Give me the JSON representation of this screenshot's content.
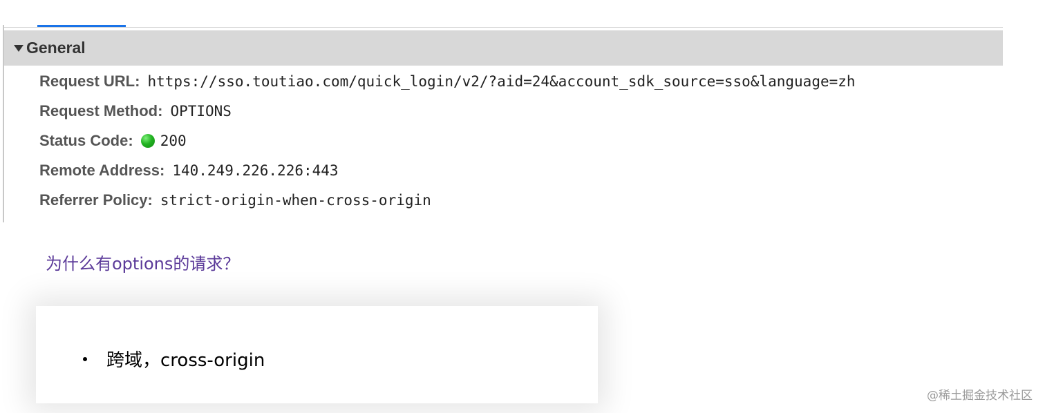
{
  "general": {
    "title": "General",
    "rows": [
      {
        "label": "Request URL:",
        "value": "https://sso.toutiao.com/quick_login/v2/?aid=24&account_sdk_source=sso&language=zh"
      },
      {
        "label": "Request Method:",
        "value": "OPTIONS"
      },
      {
        "label": "Status Code:",
        "value": "200",
        "status_color": "#22b322"
      },
      {
        "label": "Remote Address:",
        "value": "140.249.226.226:443"
      },
      {
        "label": "Referrer Policy:",
        "value": "strict-origin-when-cross-origin"
      }
    ]
  },
  "question": "为什么有options的请求？",
  "card": {
    "items": [
      "跨域，cross-origin"
    ]
  },
  "watermark": "@稀土掘金技术社区",
  "colors": {
    "accent": "#1a73e8",
    "question": "#5b3a99",
    "header_bg": "#d8d8d8"
  }
}
